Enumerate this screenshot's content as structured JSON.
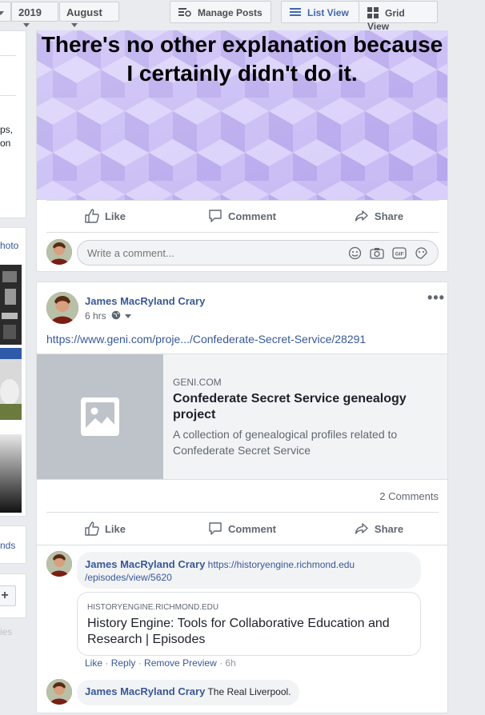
{
  "toolbar": {
    "year": "2019",
    "month": "August",
    "manage_posts": "Manage Posts",
    "list_view": "List View",
    "grid_view": "Grid View"
  },
  "left_column": {
    "fragment_a": "ps,",
    "fragment_b": "on",
    "photo_link": "hoto",
    "friends_link": "nds",
    "plus": "+",
    "faded": "ies"
  },
  "post1": {
    "meme_text": "There's no other explanation because I certainly didn't do it.",
    "like": "Like",
    "comment": "Comment",
    "share": "Share",
    "comment_placeholder": "Write a comment..."
  },
  "post2": {
    "author": "James MacRyland Crary",
    "time": "6 hrs",
    "more": "•••",
    "url_text": "https://www.geni.com/proje.../Confederate-Secret-Service/28291",
    "preview": {
      "domain": "GENI.COM",
      "title": "Confederate Secret Service genealogy project",
      "description": "A collection of genealogical profiles related to Confederate Secret Service"
    },
    "comments_count": "2 Comments",
    "like": "Like",
    "comment": "Comment",
    "share": "Share",
    "comments": [
      {
        "author": "James MacRyland Crary",
        "link_line1": "https://historyengine.richmond.edu",
        "link_line2": "/episodes/view/5620",
        "preview_domain": "HISTORYENGINE.RICHMOND.EDU",
        "preview_title": "History Engine: Tools for Collaborative Education and Research | Episodes",
        "actions": {
          "like": "Like",
          "reply": "Reply",
          "remove_preview": "Remove Preview",
          "time": "6h"
        }
      },
      {
        "author": "James MacRyland Crary",
        "text": "The Real Liverpool."
      }
    ]
  },
  "colors": {
    "link": "#385898",
    "meme_bg": "#c5b8f2",
    "page_bg": "#e9ebee"
  }
}
